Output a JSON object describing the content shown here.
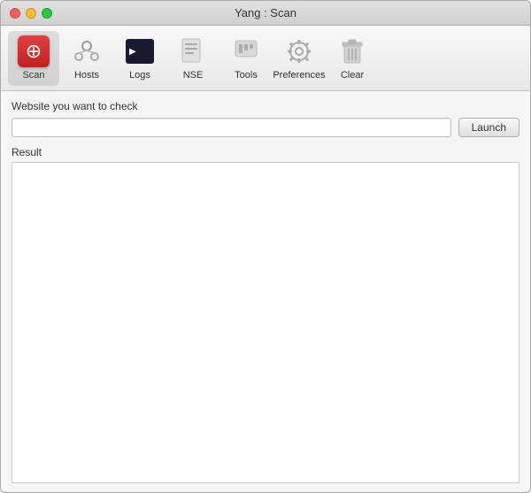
{
  "window": {
    "title": "Yang : Scan"
  },
  "toolbar": {
    "items": [
      {
        "id": "scan",
        "label": "Scan",
        "icon": "scan-icon"
      },
      {
        "id": "hosts",
        "label": "Hosts",
        "icon": "hosts-icon"
      },
      {
        "id": "logs",
        "label": "Logs",
        "icon": "logs-icon"
      },
      {
        "id": "nse",
        "label": "NSE",
        "icon": "nse-icon"
      },
      {
        "id": "tools",
        "label": "Tools",
        "icon": "tools-icon"
      },
      {
        "id": "preferences",
        "label": "Preferences",
        "icon": "prefs-icon"
      },
      {
        "id": "clear",
        "label": "Clear",
        "icon": "clear-icon"
      }
    ]
  },
  "main": {
    "input_label": "Website you want to check",
    "input_placeholder": "",
    "launch_label": "Launch",
    "result_label": "Result"
  }
}
